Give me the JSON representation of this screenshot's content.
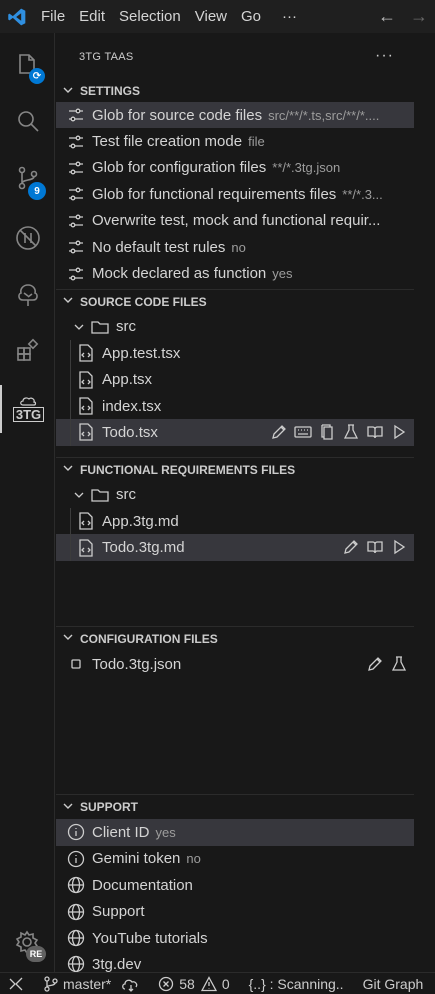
{
  "menu": {
    "file": "File",
    "edit": "Edit",
    "selection": "Selection",
    "view": "View",
    "go": "Go",
    "more": "···"
  },
  "activity": {
    "scm_badge": "9",
    "tool_label": "3TG",
    "account_badge": "RE"
  },
  "sidebar": {
    "title": "3TG TAAS",
    "more": "···"
  },
  "settings": {
    "header": "SETTINGS",
    "items": [
      {
        "label": "Glob for source code files",
        "value": "src/**/*.ts,src/**/*...."
      },
      {
        "label": "Test file creation mode",
        "value": "file"
      },
      {
        "label": "Glob for configuration files",
        "value": "**/*.3tg.json"
      },
      {
        "label": "Glob for functional requirements files",
        "value": "**/*.3..."
      },
      {
        "label": "Overwrite test, mock and functional requir...",
        "value": ""
      },
      {
        "label": "No default test rules",
        "value": "no"
      },
      {
        "label": "Mock declared as function",
        "value": "yes"
      }
    ]
  },
  "source_files": {
    "header": "SOURCE CODE FILES",
    "folder": "src",
    "files": [
      "App.test.tsx",
      "App.tsx",
      "index.tsx",
      "Todo.tsx"
    ]
  },
  "functional_files": {
    "header": "FUNCTIONAL REQUIREMENTS FILES",
    "folder": "src",
    "files": [
      "App.3tg.md",
      "Todo.3tg.md"
    ]
  },
  "config_files": {
    "header": "CONFIGURATION FILES",
    "files": [
      "Todo.3tg.json"
    ]
  },
  "support": {
    "header": "SUPPORT",
    "items": [
      {
        "label": "Client ID",
        "value": "yes",
        "icon": "info-icon"
      },
      {
        "label": "Gemini token",
        "value": "no",
        "icon": "info-icon"
      },
      {
        "label": "Documentation",
        "value": "",
        "icon": "globe-icon"
      },
      {
        "label": "Support",
        "value": "",
        "icon": "globe-icon"
      },
      {
        "label": "YouTube tutorials",
        "value": "",
        "icon": "globe-icon"
      },
      {
        "label": "3tg.dev",
        "value": "",
        "icon": "globe-icon"
      }
    ]
  },
  "status": {
    "branch": "master*",
    "errors": "58",
    "warnings": "0",
    "scanning": "{..} : Scanning..",
    "git_graph": "Git Graph"
  },
  "colors": {
    "accent": "#0078d4",
    "background": "#181818",
    "selection": "#37373d"
  }
}
